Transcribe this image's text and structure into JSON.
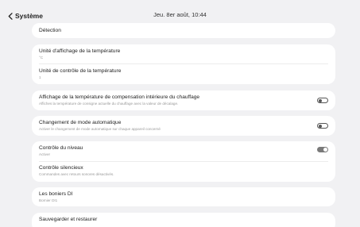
{
  "header": {
    "back_label": "Système",
    "datetime": "Jeu. 8er août, 10:44"
  },
  "items": {
    "detection": {
      "title": "Détection"
    },
    "unite_affichage": {
      "title": "Unité d'affichage de la température",
      "sub": "°C"
    },
    "unite_controle": {
      "title": "Unité de contrôle de la température",
      "sub": "1"
    },
    "compensation": {
      "title": "Affichage de la température de compensation intérieure du chauffage",
      "sub": "Affiches la température de consigne actuelle du chauffage avec la valeur de décalage.",
      "toggle": "off"
    },
    "changement_mode": {
      "title": "Changement de mode automatique",
      "sub": "Activer le changement de mode automatique sur chaque appareil concerné",
      "toggle": "off"
    },
    "controle_niveau": {
      "title": "Contrôle du niveau",
      "sub": "Activer",
      "toggle": "on"
    },
    "controle_silencieux": {
      "title": "Contrôle silencieux",
      "sub": "Commandes avec retours sonores désactivés."
    },
    "boniers": {
      "title": "Les boniers DI",
      "sub": "Bornier DI1"
    },
    "sauvegarder": {
      "title": "Sauvegarder et restaurer"
    }
  },
  "colors": {
    "background": "#f1f1f3",
    "card": "#ffffff",
    "toggle_on": "#7a7a7a",
    "toggle_off_border": "#555555"
  }
}
